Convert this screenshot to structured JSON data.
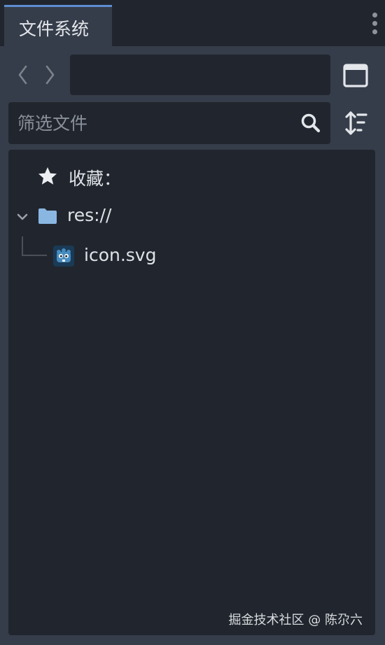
{
  "dock": {
    "tab_title": "文件系统"
  },
  "toolbar": {
    "path_value": "",
    "filter_placeholder": "筛选文件"
  },
  "tree": {
    "favorites_label": "收藏：",
    "root_label": "res://",
    "files": [
      {
        "name": "icon.svg",
        "icon": "godot-icon"
      }
    ]
  },
  "watermark": "掘金技术社区 @ 陈尕六",
  "colors": {
    "panel_bg": "#363d4a",
    "field_bg": "#21262e",
    "accent": "#5e8ed1",
    "folder": "#8ab7e2",
    "godot_blue": "#478cbf"
  }
}
